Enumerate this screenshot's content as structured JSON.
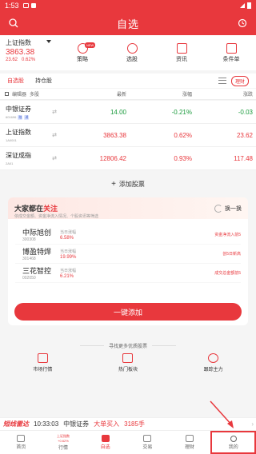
{
  "status": {
    "time": "1:53",
    "signal": "5G",
    "battery": "■"
  },
  "titlebar": {
    "title": "自选",
    "left_icon": "search-icon",
    "right_icon": "history-icon"
  },
  "index": {
    "name": "上证指数",
    "value": "3863.38",
    "change": "23.62",
    "percent": "0.62%"
  },
  "quick": [
    {
      "label": "策略",
      "badge": "NEW"
    },
    {
      "label": "选股"
    },
    {
      "label": "资讯"
    },
    {
      "label": "条件单"
    }
  ],
  "tabs": {
    "self": "自选股",
    "holding": "持仓股",
    "finance": "理财"
  },
  "columns": {
    "edit": "编辑器",
    "multi": "多股",
    "price": "最新",
    "pct": "涨幅",
    "chg": "涨跌"
  },
  "stocks": [
    {
      "name": "中银证券",
      "code": "601696",
      "tags": [
        "融",
        "通"
      ],
      "price": "14.00",
      "pct": "-0.21%",
      "chg": "-0.03",
      "dir": "down"
    },
    {
      "name": "上证指数",
      "code": "1A0001",
      "tags": [],
      "price": "3863.38",
      "pct": "0.62%",
      "chg": "23.62",
      "dir": "up"
    },
    {
      "name": "深证成指",
      "code": "2A01",
      "tags": [],
      "price": "12806.42",
      "pct": "0.93%",
      "chg": "117.48",
      "dir": "up"
    }
  ],
  "add_stock": "添加股票",
  "card": {
    "title_a": "大家都在",
    "title_b": "关注",
    "subtitle": "依成交金额、资金净流入情况、个股资讯等筛选",
    "refresh": "换一换",
    "items": [
      {
        "name": "中际旭创",
        "code": "300308",
        "label": "当日涨幅",
        "rate": "6.58%",
        "reason": "资金净流入前5"
      },
      {
        "name": "博盈特焊",
        "code": "301468",
        "label": "当日涨幅",
        "rate": "19.99%",
        "reason": "创5日新高"
      },
      {
        "name": "三花智控",
        "code": "002050",
        "label": "当日涨幅",
        "rate": "6.21%",
        "reason": "成交总金额前5"
      }
    ],
    "button": "一键添加"
  },
  "find_more": "寻找更多优质股票",
  "features": [
    "市场行情",
    "热门板块",
    "跟踪主力"
  ],
  "ticker": {
    "brand": "短线雷达",
    "time": "10:33:03",
    "stock": "中银证券",
    "action": "大单买入",
    "amount": "3185手"
  },
  "nav": {
    "home": "首页",
    "market_top": "上证指数",
    "market_mid": "+0.62%",
    "market": "行情",
    "self": "自选",
    "trade": "交易",
    "finance": "理财",
    "mine": "我的"
  }
}
